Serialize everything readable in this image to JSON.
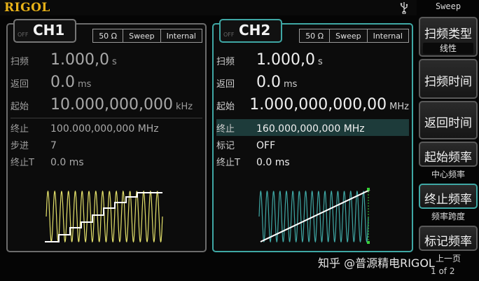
{
  "brand": "RIGOL",
  "menu": {
    "title": "Sweep",
    "keys": [
      {
        "label": "扫频类型",
        "sub": "线性"
      },
      {
        "label": "扫频时间",
        "sub": ""
      },
      {
        "label": "返回时间",
        "sub": ""
      },
      {
        "label": "起始频率",
        "sub": ""
      },
      {
        "label": "终止频率",
        "sub": ""
      },
      {
        "label": "标记频率",
        "sub": ""
      }
    ],
    "notes": {
      "after_start": "中心频率",
      "after_stop": "频率跨度"
    },
    "page_up": "上一页",
    "page_indicator": "1 of 2"
  },
  "ch1": {
    "off": "OFF",
    "name": "CH1",
    "tags": [
      "50 Ω",
      "Sweep",
      "Internal"
    ],
    "rows": [
      {
        "label": "扫频",
        "value": "1.000,0",
        "unit": "s"
      },
      {
        "label": "返回",
        "value": "0.0",
        "unit": "ms"
      },
      {
        "label": "起始",
        "value": "10.000,000,000",
        "unit": "kHz"
      },
      {
        "label": "终止",
        "value": "100.000,000,000 MHz"
      },
      {
        "label": "步进",
        "value": "7"
      },
      {
        "label": "终止T",
        "value": "0.0 ms"
      }
    ]
  },
  "ch2": {
    "off": "OFF",
    "name": "CH2",
    "tags": [
      "50 Ω",
      "Sweep",
      "Internal"
    ],
    "rows": [
      {
        "label": "扫频",
        "value": "1.000,0",
        "unit": "s"
      },
      {
        "label": "返回",
        "value": "0.0",
        "unit": "ms"
      },
      {
        "label": "起始",
        "value": "1.000,000,000,00",
        "unit": "MHz"
      },
      {
        "label": "终止",
        "value": "160.000,000,000 MHz"
      },
      {
        "label": "标记",
        "value": "OFF"
      },
      {
        "label": "终止T",
        "value": "0.0 ms"
      }
    ]
  },
  "watermark": "知乎 @普源精电RIGOL",
  "colors": {
    "brand": "#e8b218",
    "ch1_wave": "#e3e06a",
    "ch2_wave": "#3fa7a4",
    "ch2_accent": "#3fa7a4",
    "marker": "#3ad13a"
  }
}
